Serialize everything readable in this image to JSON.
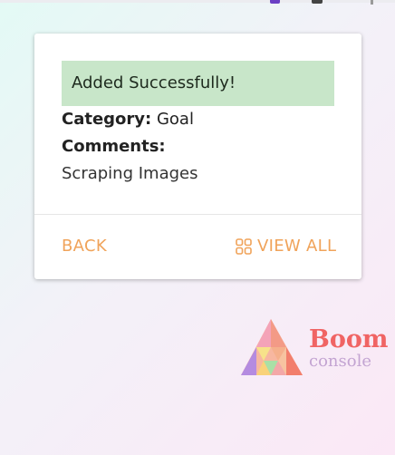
{
  "alert": {
    "message": "Added Successfully!"
  },
  "details": {
    "category_label": "Category:",
    "category_value": "Goal",
    "comments_label": "Comments:",
    "comments_value": "Scraping Images"
  },
  "actions": {
    "back_label": "BACK",
    "view_all_label": "VIEW ALL",
    "view_all_icon": "grid-icon"
  },
  "branding": {
    "logo_word": "Boom",
    "logo_sub": "console"
  },
  "colors": {
    "alert_bg": "#c8e6c9",
    "action_text": "#f0a35a",
    "logo_word": "#f06464",
    "logo_sub": "#c3a4d2"
  }
}
